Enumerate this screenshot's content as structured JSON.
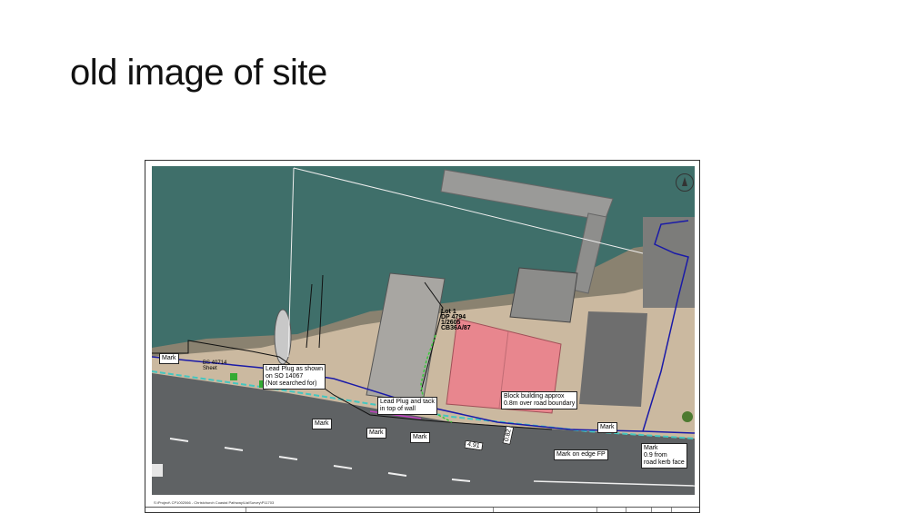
{
  "slide": {
    "title": "old image of site"
  },
  "figure": {
    "footer_path": "S:\\Project\\ CP1002066 - Christchurch Coastal Pathway\\Ua\\Survey\\P11703",
    "lot_label": {
      "lines": [
        "Lot 1",
        "DP 4794",
        "1/2605",
        "CB36A/87"
      ]
    },
    "bs_label": {
      "lines": [
        "BS 40714",
        "Sheet"
      ]
    },
    "labels": {
      "mark_left": "Mark",
      "lead_plug_so": [
        "Lead Plug as shown",
        "on SO 14067",
        "(Not searched for)"
      ],
      "lead_plug_tack": [
        "Lead Plug and tack",
        "in top of wall"
      ],
      "block_building": [
        "Block building approx",
        "0.8m over road boundary"
      ],
      "mark_mid1": "Mark",
      "mark_mid2": "Mark",
      "mark_mid3": "Mark",
      "mark_right": "Mark",
      "mark_edge_fp": "Mark on edge FP",
      "mark_kerb": [
        "Mark",
        "0.9 from",
        "road kerb face"
      ]
    },
    "dims": {
      "d1": "4.91",
      "d2": "0.82"
    },
    "colors": {
      "water": "#3f6f6a",
      "roof": "#e8868e",
      "boundary_blue": "#1a1aa8",
      "road": "#5f6264",
      "footpath_cyan": "#45c6c0"
    }
  }
}
